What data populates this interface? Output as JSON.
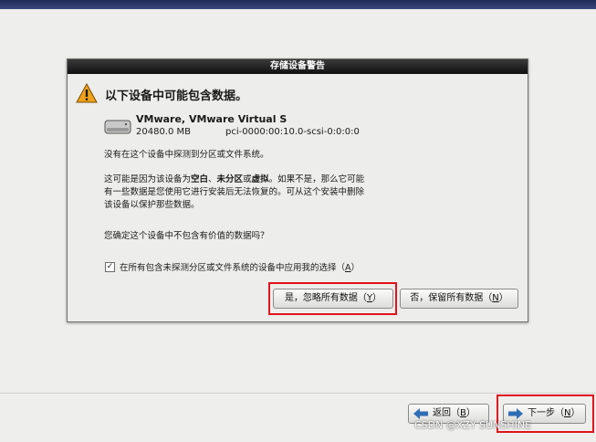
{
  "dialog": {
    "title": "存储设备警告",
    "headline": "以下设备中可能包含数据。",
    "device": {
      "name": "VMware, VMware Virtual S",
      "size": "20480.0 MB",
      "path": "pci-0000:00:10.0-scsi-0:0:0:0"
    },
    "msg_no_partitions": "没有在这个设备中探测到分区或文件系统。",
    "msg_reason": {
      "p1": "这可能是因为该设备为",
      "b1": "空白",
      "p2": "、",
      "b2": "未分区",
      "p3": "或",
      "b3": "虚拟",
      "p4": "。如果不是，那么它可能",
      "line2": "有一些数据是您使用它进行安装后无法恢复的。可从这个安装中删除",
      "line3": "该设备以保护那些数据。"
    },
    "msg_confirm": "您确定这个设备中不包含有价值的数据吗？",
    "checkbox": {
      "checked": true,
      "mark": "✓",
      "label_prefix": "在所有包含未探测分区或文件系统的设备中应用我的选择（",
      "mnemonic": "A",
      "label_suffix": "）"
    },
    "btn_yes": {
      "prefix": "是，忽略所有数据（",
      "mnemonic": "Y",
      "suffix": "）"
    },
    "btn_no": {
      "prefix": "否，保留所有数据（",
      "mnemonic": "N",
      "suffix": "）"
    }
  },
  "nav": {
    "back": {
      "prefix": "返回（",
      "mnemonic": "B",
      "suffix": "）"
    },
    "next": {
      "prefix": "下一步（",
      "mnemonic": "N",
      "suffix": "）"
    }
  },
  "watermark": "CSDN @XZY SUNSHINE",
  "colors": {
    "highlight_box": "#e0121b",
    "title_bar": "#1a1a1a",
    "warning_triangle": "#f0a21a",
    "nav_arrow": "#2f6db5"
  }
}
